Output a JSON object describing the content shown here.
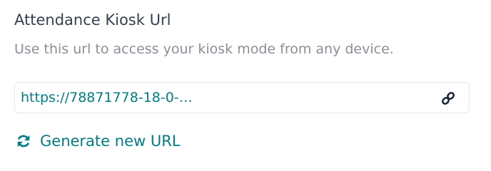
{
  "setting": {
    "title": "Attendance Kiosk Url",
    "description": "Use this url to access your kiosk mode from any device."
  },
  "kiosk_url": {
    "display_value": "https://78871778-18-0-…"
  },
  "generate_button": {
    "label": "Generate new URL"
  },
  "icons": {
    "copy": "link-icon",
    "generate": "refresh-icon"
  },
  "colors": {
    "accent": "#017e84",
    "title": "#374151",
    "muted": "#8a8f98",
    "border": "#e5e7eb"
  }
}
